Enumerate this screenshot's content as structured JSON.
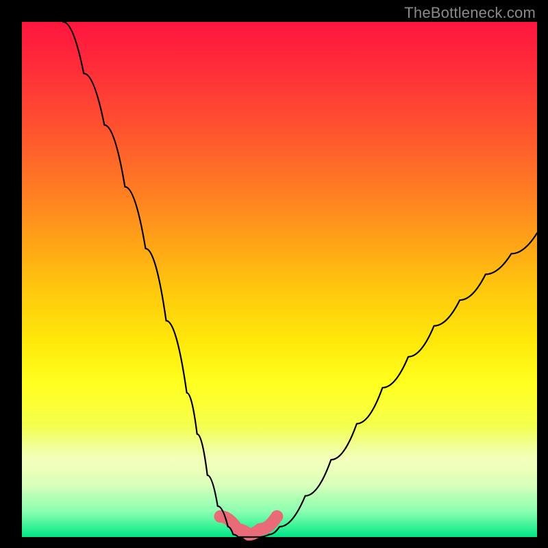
{
  "watermark": {
    "text": "TheBottleneck.com"
  },
  "colors": {
    "black_curve": "#000000",
    "pink_band": "#e96b78",
    "pink_band_outline": "#e96b78"
  },
  "chart_data": {
    "type": "line",
    "title": "",
    "xlabel": "",
    "ylabel": "",
    "xlim": [
      0,
      100
    ],
    "ylim": [
      0,
      100
    ],
    "grid": false,
    "legend": false,
    "series": [
      {
        "name": "bottleneck-curve",
        "x": [
          8,
          12,
          16,
          20,
          24,
          28,
          32,
          34,
          36,
          38,
          40,
          41,
          42,
          44,
          46,
          48,
          50,
          55,
          60,
          65,
          70,
          75,
          80,
          85,
          90,
          95,
          100
        ],
        "y": [
          100,
          90,
          80,
          68,
          56,
          42,
          28,
          20,
          12,
          6,
          2,
          0.5,
          0,
          0,
          0,
          0.5,
          2,
          8,
          15,
          22,
          29,
          35,
          41,
          46,
          51,
          55,
          59
        ]
      }
    ],
    "flat_region": {
      "x_start": 41,
      "x_end": 48,
      "y": 0
    },
    "annotation_band": {
      "description": "optimal range highlight near bottom of V",
      "x_start": 38.5,
      "x_end": 49.5,
      "y_center": 2.5,
      "y_half_height": 2.5
    }
  }
}
